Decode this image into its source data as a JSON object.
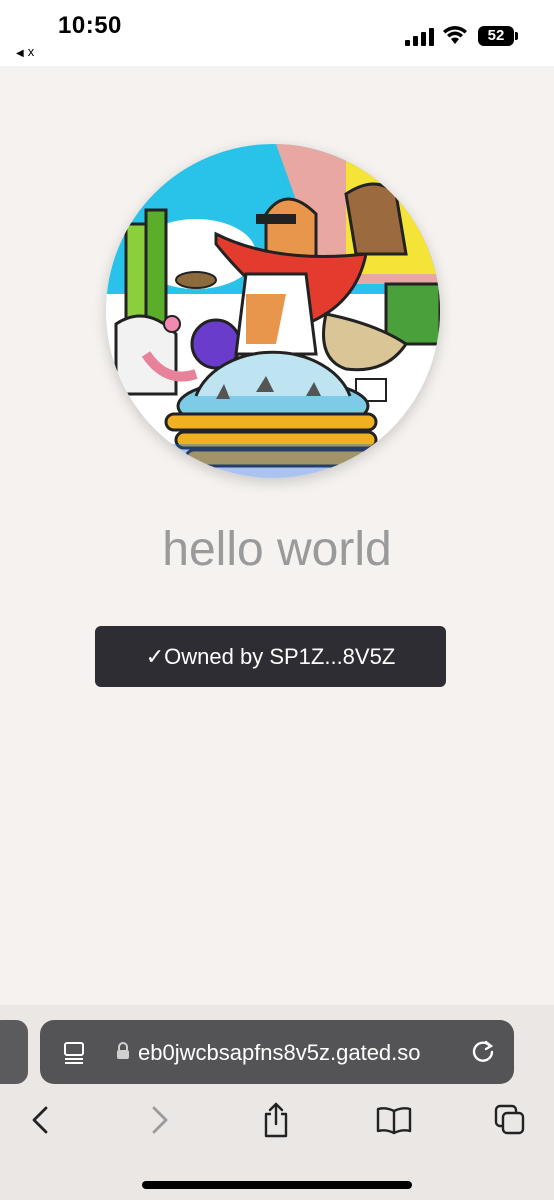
{
  "status": {
    "time": "10:50",
    "back_label": "x",
    "battery": "52"
  },
  "profile": {
    "title": "hello world",
    "owner_badge": "✓Owned by SP1Z...8V5Z",
    "avatar_icon": "nft-cartoon-corgi-avatar"
  },
  "browser": {
    "url": "eb0jwcbsapfns8v5z.gated.so",
    "icons": [
      "reader-icon",
      "lock-icon",
      "reload-icon",
      "back-icon",
      "forward-icon",
      "share-icon",
      "bookmarks-icon",
      "tabs-icon"
    ]
  },
  "colors": {
    "page_bg": "#f5f2ef",
    "badge_bg": "#2d2d33",
    "title": "#9a9a9a",
    "address_bar": "#545457"
  }
}
